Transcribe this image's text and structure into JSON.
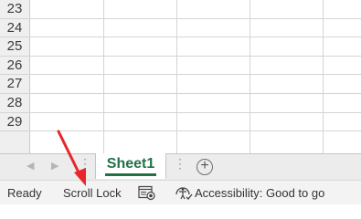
{
  "grid": {
    "rows": [
      "23",
      "24",
      "25",
      "26",
      "27",
      "28",
      "29"
    ]
  },
  "tabs": {
    "active_sheet": "Sheet1",
    "add_sheet_glyph": "+",
    "accent_color": "#217346"
  },
  "status_bar": {
    "ready": "Ready",
    "scroll_lock": "Scroll Lock",
    "accessibility": "Accessibility: Good to go"
  },
  "annotation": {
    "arrow_color": "#e8262b"
  }
}
